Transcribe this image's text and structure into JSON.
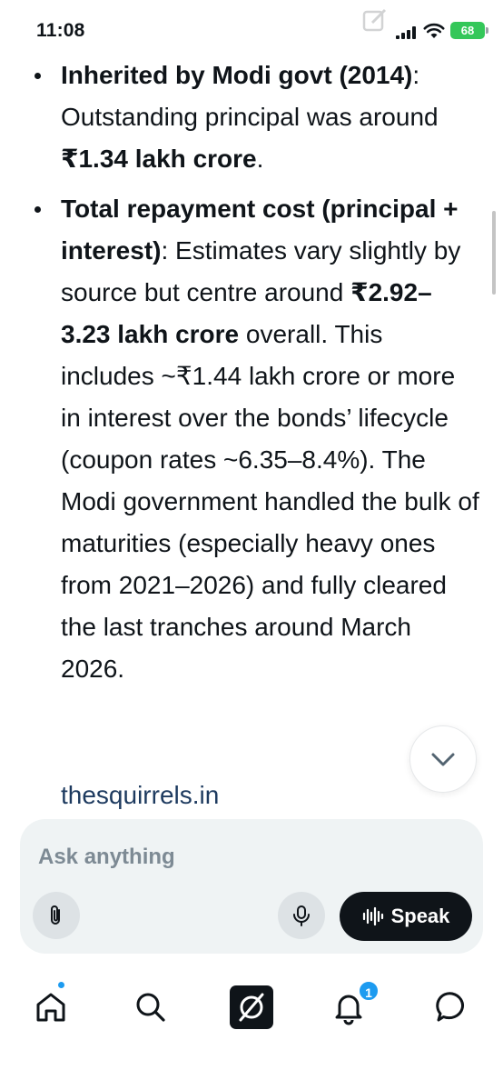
{
  "status_bar": {
    "time": "11:08",
    "battery": "68",
    "icons": [
      "signal-icon",
      "wifi-icon",
      "battery-icon"
    ]
  },
  "answer": {
    "bullets": [
      {
        "bold": "Inherited by Modi govt (2014)",
        "text_a": ": Outstanding principal was around ",
        "bold_b": "₹1.34 lakh crore",
        "text_b": "."
      },
      {
        "bold": "Total repayment cost (principal + interest)",
        "text_a": ": Estimates vary slightly by source but centre around ",
        "bold_b": "₹2.92–3.23 lakh crore",
        "text_b": " overall. This includes ~₹1.44 lakh crore or more in interest over the bonds’ lifecycle (coupon rates ~6.35–8.4%). The Modi government handled the bulk of maturities (especially heavy ones from 2021–2026) and fully cleared the last tranches around March 2026."
      }
    ],
    "source": "thesquirrels.in"
  },
  "composer": {
    "placeholder": "Ask anything",
    "speak_label": "Speak"
  },
  "nav": {
    "items": [
      "home-icon",
      "search-icon",
      "grok-icon",
      "notifications-icon",
      "messages-icon"
    ],
    "notification_count": "1"
  },
  "colors": {
    "accent": "#1d9bf0",
    "text": "#0f1419",
    "composer_bg": "#eff3f4",
    "battery": "#34c759"
  }
}
